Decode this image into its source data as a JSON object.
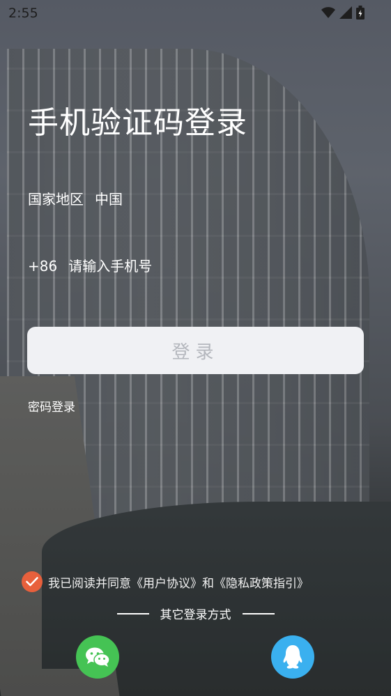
{
  "status_bar": {
    "time": "2:55"
  },
  "title": "手机验证码登录",
  "region": {
    "label": "国家地区",
    "value": "中国"
  },
  "phone": {
    "country_code": "+86",
    "placeholder": "请输入手机号",
    "value": ""
  },
  "login_button_label": "登录",
  "password_login_label": "密码登录",
  "agreement": {
    "text": "我已阅读并同意《用户协议》和《隐私政策指引》",
    "checked": true
  },
  "other_login_label": "其它登录方式",
  "social": [
    {
      "name": "wechat",
      "icon": "wechat-icon",
      "color": "#45c354"
    },
    {
      "name": "qq",
      "icon": "qq-icon",
      "color": "#3ab0ef"
    }
  ],
  "colors": {
    "accent": "#e8603c",
    "login_button_bg": "#f0f1f4",
    "login_button_text": "#b4b7bd"
  }
}
